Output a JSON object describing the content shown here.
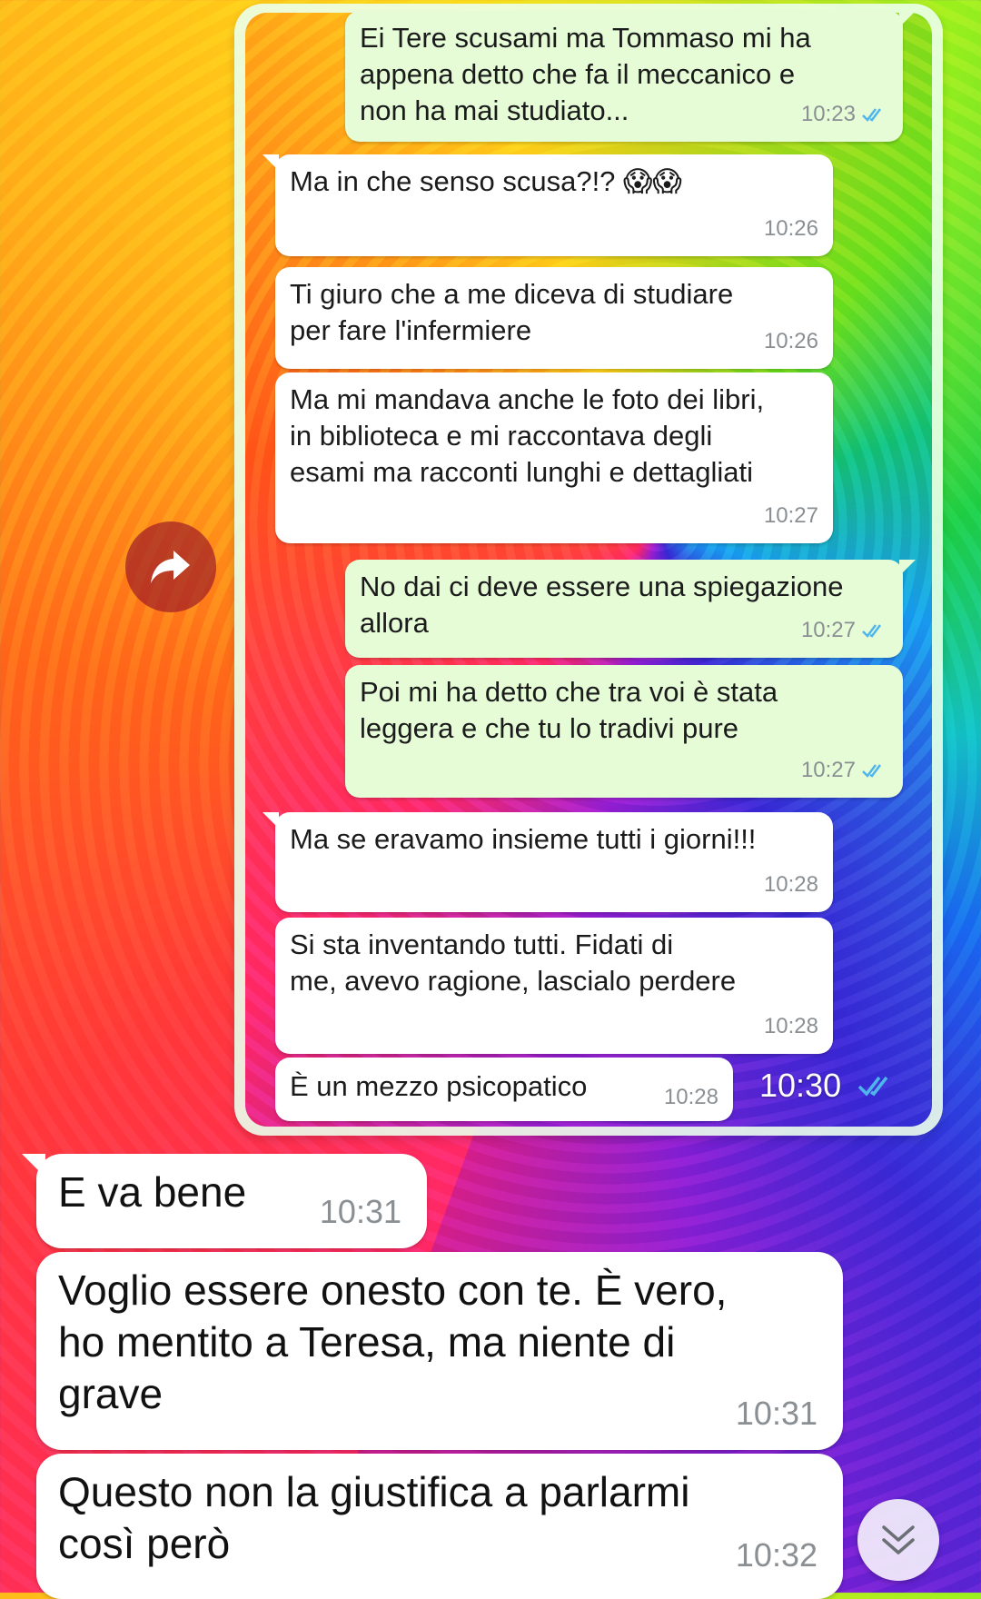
{
  "screenshot": {
    "messages": [
      {
        "dir": "out",
        "text": "Ei Tere scusami ma Tommaso mi ha\nappena detto che fa il meccanico e\nnon ha mai studiato...",
        "time": "10:23"
      },
      {
        "dir": "in",
        "text": "Ma in che senso scusa?!? 😱😱",
        "time": "10:26"
      },
      {
        "dir": "in",
        "text": "Ti giuro che a me diceva di studiare\nper fare l'infermiere",
        "time": "10:26"
      },
      {
        "dir": "in",
        "text": "Ma mi mandava anche le foto dei libri,\nin biblioteca e mi raccontava degli\nesami ma racconti lunghi e dettagliati",
        "time": "10:27"
      },
      {
        "dir": "out",
        "text": "No dai ci deve essere una spiegazione\nallora",
        "time": "10:27"
      },
      {
        "dir": "out",
        "text": "Poi mi ha detto che tra voi è stata\nleggera e che tu lo tradivi pure",
        "time": "10:27"
      },
      {
        "dir": "in",
        "text": "Ma se eravamo insieme tutti i giorni!!!",
        "time": "10:28"
      },
      {
        "dir": "in",
        "text": "Si sta inventando tutti. Fidati di\nme, avevo ragione, lascialo perdere",
        "time": "10:28"
      },
      {
        "dir": "in",
        "text": "È un mezzo psicopatico",
        "time": "10:28"
      }
    ],
    "forward_time": "10:30"
  },
  "chat": {
    "messages": [
      {
        "text": "E va bene",
        "time": "10:31"
      },
      {
        "text": "Voglio essere onesto con te. È vero,\nho mentito a Teresa, ma niente di\ngrave",
        "time": "10:31"
      },
      {
        "text": "Questo non la giustifica a parlarmi\ncosì però",
        "time": "10:32"
      }
    ]
  },
  "icons": {
    "forward": "forward-arrow-icon",
    "read": "double-check-icon",
    "scroll": "chevron-double-down-icon"
  },
  "colors": {
    "incoming_bubble": "#ffffff",
    "outgoing_bubble": "#e5fcd7",
    "read_tick": "#4fb6ec"
  }
}
